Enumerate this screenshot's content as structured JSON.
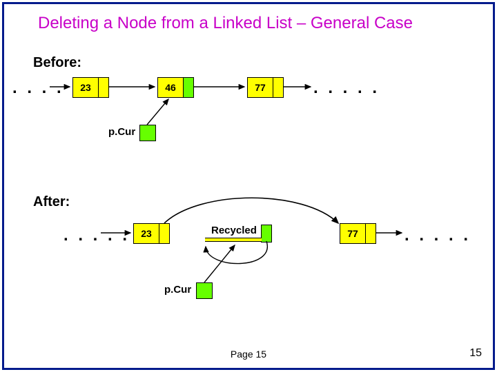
{
  "title": "Deleting a Node from a Linked List – General Case",
  "before_label": "Before:",
  "after_label": "After:",
  "ellipsis": ". . . . .",
  "nodes": {
    "before": {
      "a": "23",
      "b": "46",
      "c": "77"
    },
    "after": {
      "a": "23",
      "c": "77"
    }
  },
  "recycled": "Recycled",
  "pcur": "p.Cur",
  "page_label": "Page 15",
  "page_num": "15"
}
